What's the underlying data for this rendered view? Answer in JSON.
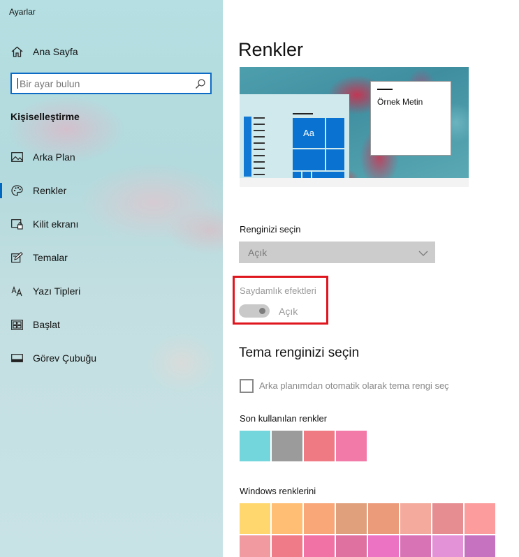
{
  "window": {
    "title": "Ayarlar"
  },
  "sidebar": {
    "home_label": "Ana Sayfa",
    "search_placeholder": "Bir ayar bulun",
    "section_title": "Kişiselleştirme",
    "items": [
      {
        "label": "Arka Plan",
        "icon": "image-icon",
        "selected": false
      },
      {
        "label": "Renkler",
        "icon": "palette-icon",
        "selected": true
      },
      {
        "label": "Kilit ekranı",
        "icon": "lock-screen-icon",
        "selected": false
      },
      {
        "label": "Temalar",
        "icon": "theme-edit-icon",
        "selected": false
      },
      {
        "label": "Yazı Tipleri",
        "icon": "font-icon",
        "selected": false
      },
      {
        "label": "Başlat",
        "icon": "start-icon",
        "selected": false
      },
      {
        "label": "Görev Çubuğu",
        "icon": "taskbar-icon",
        "selected": false
      }
    ]
  },
  "main": {
    "title": "Renkler",
    "preview": {
      "tile_text": "Aa",
      "sample_text": "Örnek Metin"
    },
    "choose_color": {
      "label": "Renginizi seçin",
      "value": "Açık"
    },
    "transparency": {
      "label": "Saydamlık efektleri",
      "state_label": "Açık",
      "on": true,
      "enabled": false
    },
    "accent": {
      "heading": "Tema renginizi seçin",
      "auto_checkbox_label": "Arka planımdan otomatik olarak tema rengi seç",
      "auto_checked": false,
      "recent_label": "Son kullanılan renkler",
      "recent_colors": [
        "#74d6dd",
        "#9b9b9b",
        "#f07a84",
        "#f27aa8"
      ],
      "windows_label": "Windows renklerini",
      "windows_colors_row1": [
        "#ffd76e",
        "#ffbe73",
        "#f9a779",
        "#e0a07c",
        "#eb9a7a",
        "#f4aa9c",
        "#e58d91",
        "#fc9c9c"
      ],
      "windows_colors_row2": [
        "#f19aa0",
        "#ef7a88",
        "#f173a5",
        "#df71a0",
        "#ec73c3",
        "#d873b6",
        "#e492d8",
        "#c772c0"
      ]
    }
  }
}
